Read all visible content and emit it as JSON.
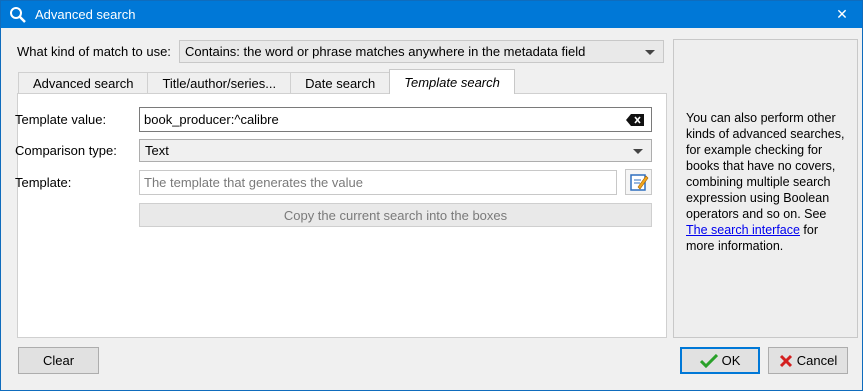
{
  "window": {
    "title": "Advanced search",
    "close_glyph": "✕"
  },
  "match": {
    "label": "What kind of match to use:",
    "selected": "Contains: the word or phrase matches anywhere in the metadata field"
  },
  "tabs": [
    {
      "label": "Advanced search"
    },
    {
      "label": "Title/author/series..."
    },
    {
      "label": "Date search"
    },
    {
      "label": "Template search"
    }
  ],
  "template_tab": {
    "value_label": "Template value:",
    "value": "book_producer:^calibre",
    "comparison_label": "Comparison type:",
    "comparison_selected": "Text",
    "template_label": "Template:",
    "template_placeholder": "The template that generates the value",
    "copy_button": "Copy the current search into the boxes"
  },
  "help": {
    "text_before": "You can also perform other kinds of advanced searches, for example checking for books that have no covers, combining multiple search expression using Boolean operators and so on. See ",
    "link": "The search interface",
    "text_after": " for more information."
  },
  "buttons": {
    "clear": "Clear",
    "ok": "OK",
    "cancel": "Cancel"
  },
  "colors": {
    "titlebar": "#0078d7",
    "link": "#0000ee",
    "ok_check": "#2aa12a",
    "cancel_x": "#d32020"
  },
  "icons": [
    "search-icon",
    "close-icon",
    "backspace-clear-icon",
    "edit-template-icon",
    "check-icon",
    "x-icon"
  ]
}
